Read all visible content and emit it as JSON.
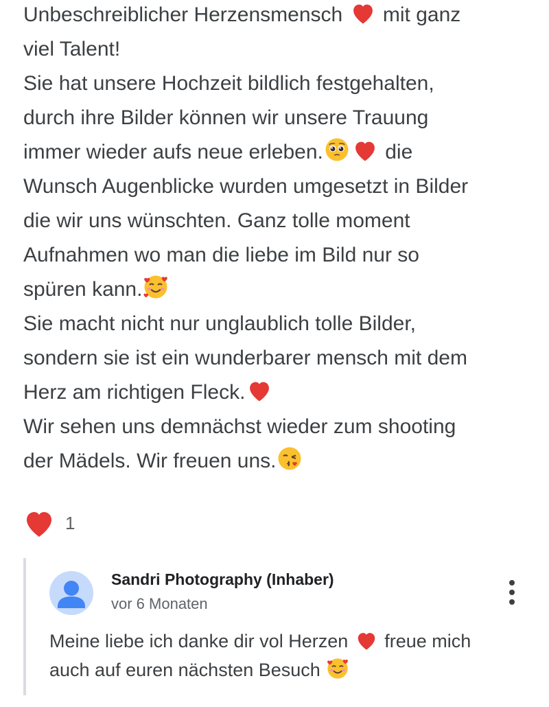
{
  "review": {
    "lines": [
      "Unbeschreiblicher Herzensmensch",
      "mit ganz",
      "viel Talent!",
      "Sie hat unsere Hochzeit bildlich festgehalten,",
      "durch ihre Bilder können wir unsere Trauung",
      "immer wieder aufs neue erleben.",
      "die",
      "Wunsch Augenblicke wurden umgesetzt in Bilder",
      "die wir uns wünschten. Ganz tolle moment",
      "Aufnahmen wo man die liebe im Bild nur so",
      "spüren kann.",
      "Sie macht nicht nur unglaublich tolle Bilder,",
      "sondern sie ist ein wunderbarer mensch mit dem",
      "Herz am richtigen Fleck.",
      "Wir sehen uns demnächst wieder zum shooting",
      "der Mädels. Wir freuen uns."
    ]
  },
  "reactions": {
    "like_icon": "red-heart-icon",
    "like_count": "1"
  },
  "owner_reply": {
    "author": "Sandri Photography (Inhaber)",
    "time": "vor 6 Monaten",
    "avatar_icon": "default-person-avatar",
    "menu_icon": "more-vert-icon",
    "text_line_1a": "Meine liebe ich danke dir vol Herzen",
    "text_line_1b": "freue mich",
    "text_line_2": "auch auf euren nächsten Besuch"
  },
  "colors": {
    "heart": "#e53935",
    "text": "#3c4043",
    "secondary_text": "#5f6368",
    "avatar_bg": "#c6dafc",
    "avatar_fg": "#4285f4",
    "reply_border": "#dadce0"
  }
}
